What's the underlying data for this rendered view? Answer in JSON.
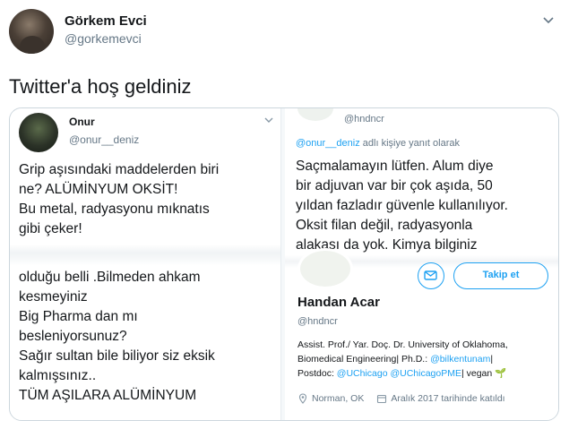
{
  "tweet": {
    "author_name": "Görkem Evci",
    "author_handle": "@gorkemevci",
    "text": "Twitter'a hoş geldiniz"
  },
  "left_panel": {
    "name": "Onur",
    "handle": "@onur__deniz",
    "text_top": "Grip aşısındaki maddelerden biri\nne? ALÜMİNYUM OKSİT!\nBu metal, radyasyonu mıknatıs\ngibi çeker!",
    "text_bottom": "olduğu belli .Bilmeden  ahkam\nkesmeyiniz\nBig Pharma dan mı\nbesleniyorsunuz?\nSağır sultan bile biliyor siz  eksik\nkalmışsınız..\nTÜM  AŞILARA ALÜMİNYUM"
  },
  "right_panel": {
    "handle_top": "@hndncr",
    "reply_link": "@onur__deniz",
    "reply_suffix": " adlı kişiye yanıt olarak",
    "text": "Saçmalamayın lütfen. Alum diye\nbir adjuvan var bir çok aşıda, 50\nyıldan fazladır güvenle kullanılıyor.\nOksit filan değil, radyasyonla\nalakası da yok. Kimya bilginiz",
    "follow_label": "Takip et",
    "name": "Handan Acar",
    "handle": "@hndncr",
    "bio_line1": "Assist. Prof./ Yar. Doç. Dr. University of Oklahoma,",
    "bio_line2a": "Biomedical Engineering| Ph.D.: ",
    "bio_link1": "@bilkentunam",
    "bio_line2b": "|",
    "bio_line3a": "Postdoc: ",
    "bio_link2": "@UChicago @UChicagoPME",
    "bio_line3b": "| vegan 🌱",
    "location": "Norman, OK",
    "joined": "Aralık 2017 tarihinde katıldı"
  },
  "colors": {
    "accent": "#1da1f2",
    "secondary_text": "#657786"
  }
}
